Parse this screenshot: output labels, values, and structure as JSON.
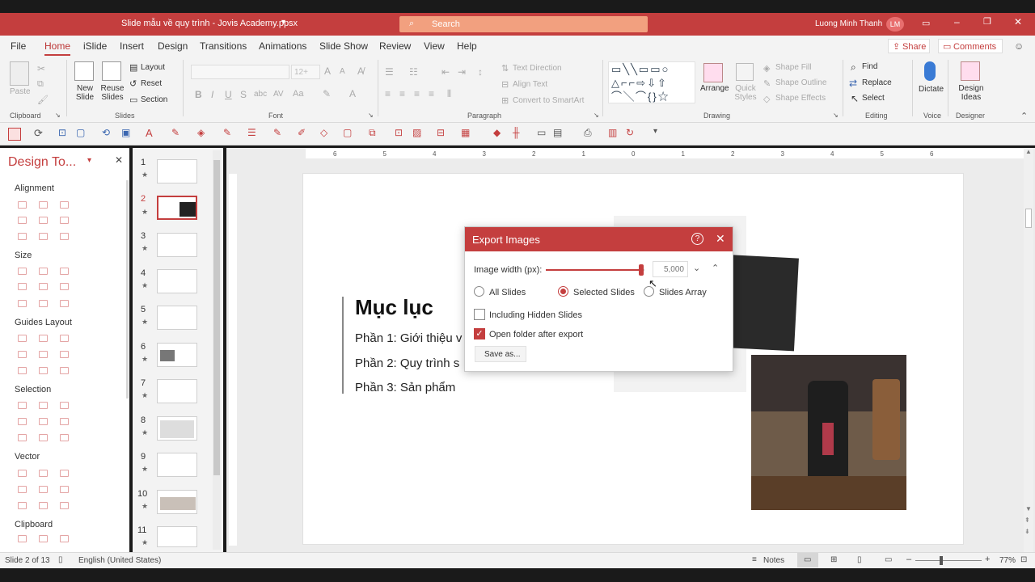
{
  "app": {
    "title": "Slide mẫu về quy trình - Jovis Academy.ppsx",
    "search_placeholder": "Search",
    "user_name": "Luong Minh Thanh",
    "user_initials": "LM"
  },
  "tabs": [
    "File",
    "Home",
    "iSlide",
    "Insert",
    "Design",
    "Transitions",
    "Animations",
    "Slide Show",
    "Review",
    "View",
    "Help"
  ],
  "ribbon": {
    "share": "Share",
    "comments": "Comments",
    "clipboard": {
      "paste": "Paste",
      "label": "Clipboard"
    },
    "slides": {
      "new_slide": "New\nSlide",
      "reuse_slides": "Reuse\nSlides",
      "layout": "Layout",
      "reset": "Reset",
      "section": "Section",
      "label": "Slides"
    },
    "font": {
      "size": "12+",
      "label": "Font"
    },
    "paragraph": {
      "text_direction": "Text Direction",
      "align_text": "Align Text",
      "convert": "Convert to SmartArt",
      "label": "Paragraph"
    },
    "drawing": {
      "arrange": "Arrange",
      "quick_styles": "Quick\nStyles",
      "shape_fill": "Shape Fill",
      "shape_outline": "Shape Outline",
      "shape_effects": "Shape Effects",
      "label": "Drawing"
    },
    "editing": {
      "find": "Find",
      "replace": "Replace",
      "select": "Select",
      "label": "Editing"
    },
    "voice": {
      "dictate": "Dictate",
      "label": "Voice"
    },
    "designer": {
      "design_ideas": "Design\nIdeas",
      "label": "Designer"
    }
  },
  "design_pane": {
    "title": "Design To...",
    "sections": [
      "Alignment",
      "Size",
      "Guides Layout",
      "Selection",
      "Vector",
      "Clipboard"
    ]
  },
  "thumbnails": [
    "1",
    "2",
    "3",
    "4",
    "5",
    "6",
    "7",
    "8",
    "9",
    "10",
    "11"
  ],
  "ruler": [
    "6",
    "5",
    "4",
    "3",
    "2",
    "1",
    "0",
    "1",
    "2",
    "3",
    "4",
    "5",
    "6"
  ],
  "slide": {
    "heading": "Mục lục",
    "items": [
      "Phần 1: Giới thiệu v",
      "Phần 2: Quy trình s",
      "Phần 3: Sản phẩm"
    ]
  },
  "dialog": {
    "title": "Export Images",
    "width_label": "Image width (px):",
    "width_value": "5,000",
    "width_fraction": 0.97,
    "options": [
      "All Slides",
      "Selected Slides",
      "Slides Array"
    ],
    "selected_option": "Selected Slides",
    "including_hidden": "Including Hidden Slides",
    "open_folder": "Open folder after export",
    "save_as": "Save as..."
  },
  "status": {
    "slide_info": "Slide 2 of 13",
    "language": "English (United States)",
    "notes": "Notes",
    "zoom": "77%"
  },
  "colors": {
    "accent": "#c43e3e",
    "title_bar": "#c43e3e"
  }
}
